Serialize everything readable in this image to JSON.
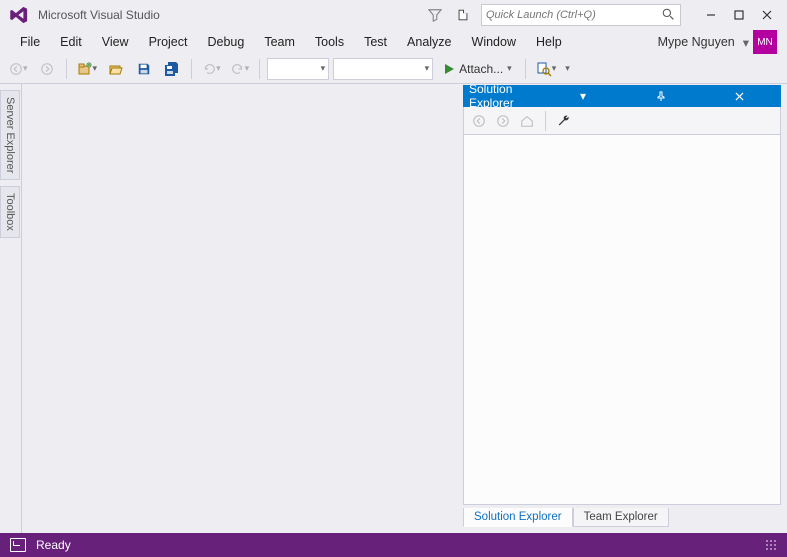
{
  "title": "Microsoft Visual Studio",
  "quick_launch_placeholder": "Quick Launch (Ctrl+Q)",
  "menu": {
    "file": "File",
    "edit": "Edit",
    "view": "View",
    "project": "Project",
    "debug": "Debug",
    "team": "Team",
    "tools": "Tools",
    "test": "Test",
    "analyze": "Analyze",
    "window": "Window",
    "help": "Help"
  },
  "user": {
    "name": "Mype Nguyen",
    "initials": "MN"
  },
  "toolbar": {
    "attach_label": "Attach..."
  },
  "side_tabs": {
    "server_explorer": "Server Explorer",
    "toolbox": "Toolbox"
  },
  "solution_explorer": {
    "title": "Solution Explorer",
    "tabs": {
      "solution": "Solution Explorer",
      "team": "Team Explorer"
    }
  },
  "status": {
    "text": "Ready"
  }
}
